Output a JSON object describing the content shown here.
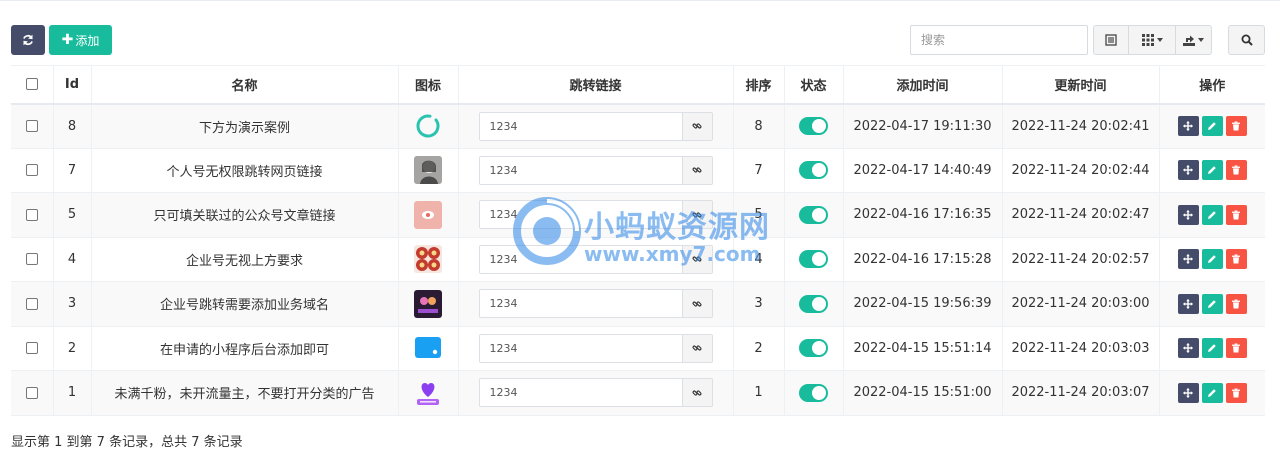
{
  "toolbar": {
    "add_label": "添加",
    "search_placeholder": "搜索"
  },
  "table": {
    "headers": {
      "id": "Id",
      "name": "名称",
      "icon": "图标",
      "link": "跳转链接",
      "sort": "排序",
      "status": "状态",
      "created": "添加时间",
      "updated": "更新时间",
      "ops": "操作"
    },
    "rows": [
      {
        "id": "8",
        "name": "下方为演示案例",
        "icon": "loading-ring-icon",
        "link": "1234",
        "sort": "8",
        "status": "on",
        "created": "2022-04-17 19:11:30",
        "updated": "2022-11-24 20:02:41"
      },
      {
        "id": "7",
        "name": "个人号无权限跳转网页链接",
        "icon": "photo-thumb",
        "link": "1234",
        "sort": "7",
        "status": "on",
        "created": "2022-04-17 14:40:49",
        "updated": "2022-11-24 20:02:44"
      },
      {
        "id": "5",
        "name": "只可填关联过的公众号文章链接",
        "icon": "pink-card-thumb",
        "link": "1234",
        "sort": "5",
        "status": "on",
        "created": "2022-04-16 17:16:35",
        "updated": "2022-11-24 20:02:47"
      },
      {
        "id": "4",
        "name": "企业号无视上方要求",
        "icon": "red-grid-thumb",
        "link": "1234",
        "sort": "4",
        "status": "on",
        "created": "2022-04-16 17:15:28",
        "updated": "2022-11-24 20:02:57"
      },
      {
        "id": "3",
        "name": "企业号跳转需要添加业务域名",
        "icon": "dark-poster-thumb",
        "link": "1234",
        "sort": "3",
        "status": "on",
        "created": "2022-04-15 19:56:39",
        "updated": "2022-11-24 20:03:00"
      },
      {
        "id": "2",
        "name": "在申请的小程序后台添加即可",
        "icon": "blue-chat-icon",
        "link": "1234",
        "sort": "2",
        "status": "on",
        "created": "2022-04-15 15:51:14",
        "updated": "2022-11-24 20:03:03"
      },
      {
        "id": "1",
        "name": "未满千粉，未开流量主，不要打开分类的广告",
        "icon": "purple-heart-icon",
        "link": "1234",
        "sort": "1",
        "status": "on",
        "created": "2022-04-15 15:51:00",
        "updated": "2022-11-24 20:03:07"
      }
    ]
  },
  "footer": {
    "summary": "显示第 1 到第 7 条记录，总共 7 条记录"
  },
  "watermark": {
    "title": "小蚂蚁资源网",
    "url": "www.xmy7.com"
  },
  "colors": {
    "primary_dark": "#444c69",
    "success": "#18bc9c",
    "danger": "#f75444",
    "watermark": "#3d8ee8"
  }
}
